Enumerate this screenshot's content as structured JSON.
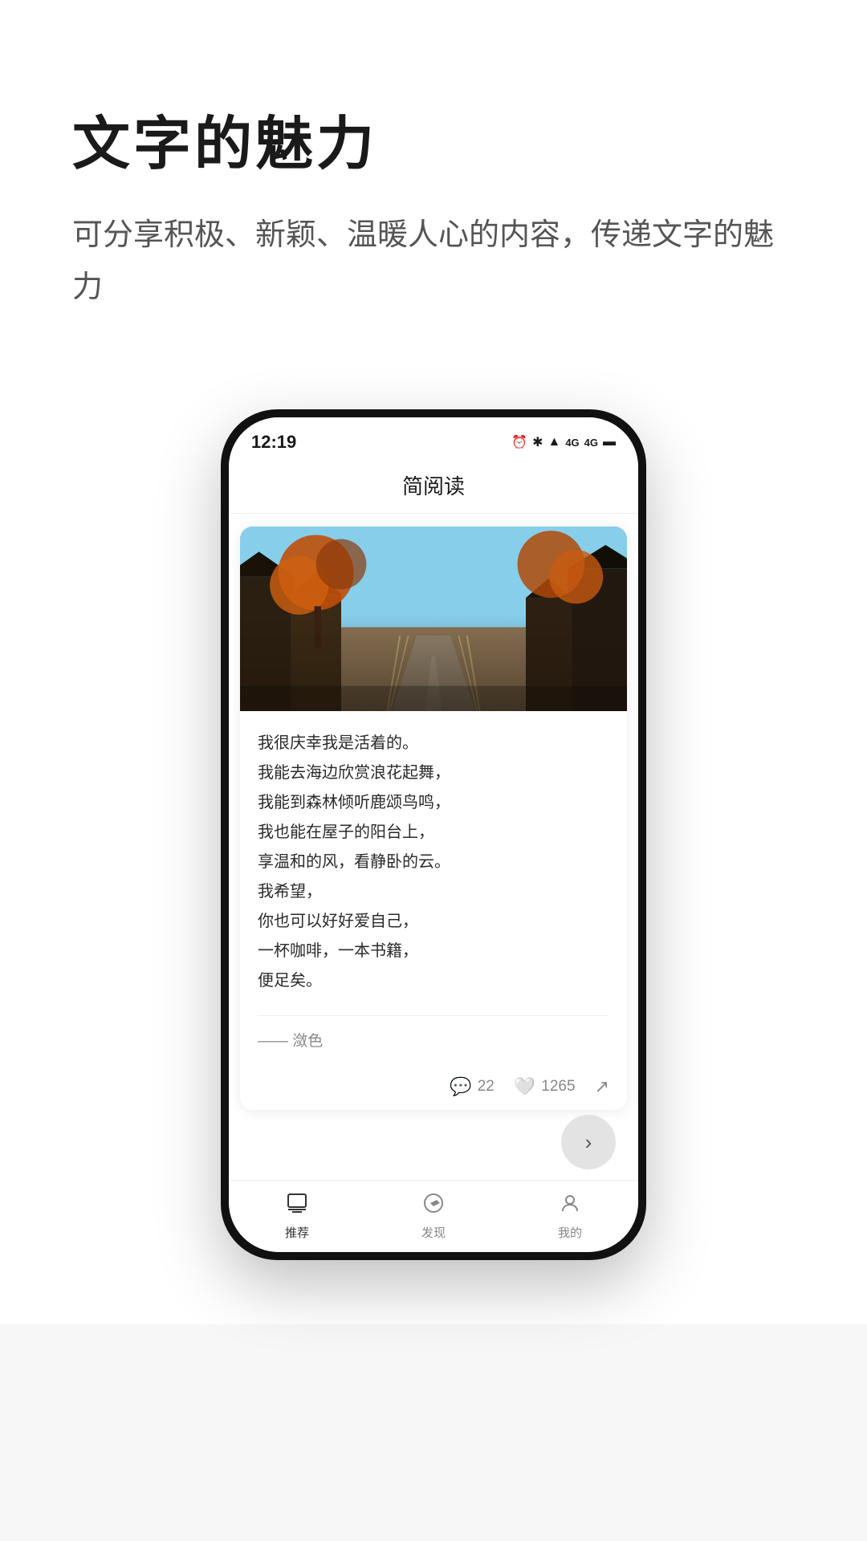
{
  "page": {
    "background": "#ffffff"
  },
  "hero": {
    "title": "文字的魅力",
    "subtitle": "可分享积极、新颖、温暖人心的内容，传递文字的魅力"
  },
  "phone": {
    "statusBar": {
      "time": "12:19",
      "networkIcon": "N",
      "icons": "⏰ ✱ ⊕ ▲ 4G 4G 🔋"
    },
    "appTitle": "简阅读",
    "article": {
      "content": "我很庆幸我是活着的。\n我能去海边欣赏浪花起舞，\n我能到森林倾听鹿颂鸟鸣，\n我也能在屋子的阳台上，\n享温和的风，看静卧的云。\n我希望，\n你也可以好好爱自己，\n一杯咖啡，一本书籍，\n便足矣。",
      "author": "—— 潋色",
      "comments": "22",
      "likes": "1265"
    },
    "navigation": {
      "items": [
        {
          "label": "推荐",
          "icon": "💻"
        },
        {
          "label": "发现",
          "icon": "🧭"
        },
        {
          "label": "我的",
          "icon": "👤"
        }
      ]
    }
  }
}
